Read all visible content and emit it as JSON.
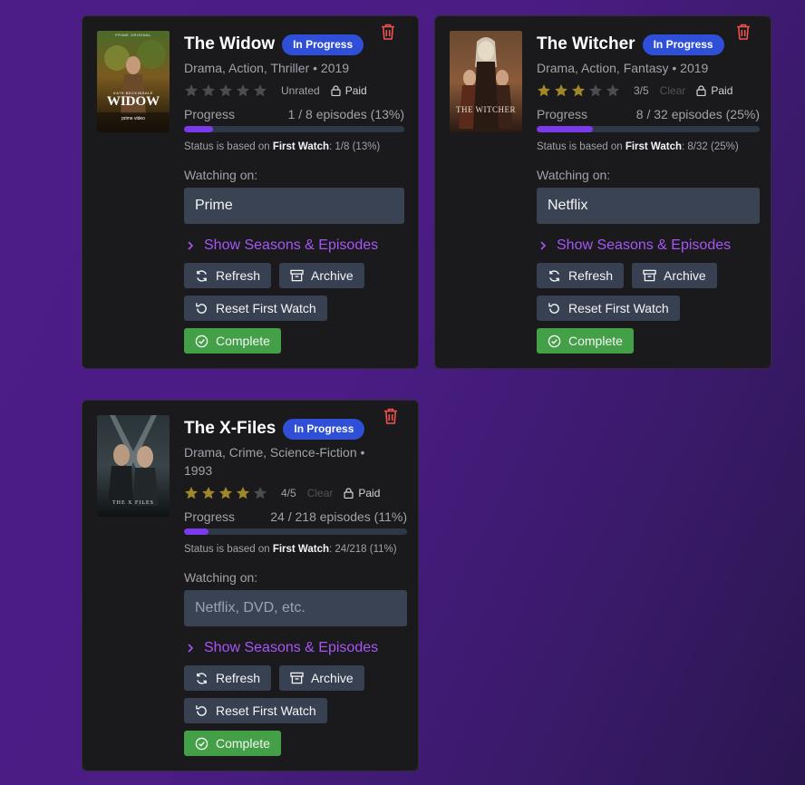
{
  "cards": [
    {
      "title": "The Widow",
      "badge": "In Progress",
      "genres": "Drama, Action, Thriller • 2019",
      "rating_text": "Unrated",
      "stars_filled": 0,
      "clear": "",
      "paid": "Paid",
      "progress_label": "Progress",
      "progress_text": "1 / 8 episodes (13%)",
      "progress_fraction": 0.13,
      "status_prefix": "Status is based on ",
      "status_strong": "First Watch",
      "status_suffix": ": 1/8 (13%)",
      "watching_label": "Watching on:",
      "watching_value": "Prime",
      "watching_placeholder": "Netflix, DVD, etc.",
      "seasons_link": "Show Seasons & Episodes",
      "refresh": "Refresh",
      "archive": "Archive",
      "reset": "Reset First Watch",
      "complete": "Complete",
      "poster": {
        "top_text": "PRIME ORIGINAL",
        "small_text": "KATE BECKINSALE",
        "big_text": "WIDOW",
        "brand": "prime video"
      }
    },
    {
      "title": "The Witcher",
      "badge": "In Progress",
      "genres": "Drama, Action, Fantasy • 2019",
      "rating_text": "3/5",
      "stars_filled": 3,
      "clear": "Clear",
      "paid": "Paid",
      "progress_label": "Progress",
      "progress_text": "8 / 32 episodes (25%)",
      "progress_fraction": 0.25,
      "status_prefix": "Status is based on ",
      "status_strong": "First Watch",
      "status_suffix": ": 8/32 (25%)",
      "watching_label": "Watching on:",
      "watching_value": "Netflix",
      "watching_placeholder": "Netflix, DVD, etc.",
      "seasons_link": "Show Seasons & Episodes",
      "refresh": "Refresh",
      "archive": "Archive",
      "reset": "Reset First Watch",
      "complete": "Complete",
      "poster": {
        "big_text": "THE WITCHER"
      }
    },
    {
      "title": "The X-Files",
      "badge": "In Progress",
      "genres": "Drama, Crime, Science-Fiction • 1993",
      "rating_text": "4/5",
      "stars_filled": 4,
      "clear": "Clear",
      "paid": "Paid",
      "progress_label": "Progress",
      "progress_text": "24 / 218 episodes (11%)",
      "progress_fraction": 0.11,
      "status_prefix": "Status is based on ",
      "status_strong": "First Watch",
      "status_suffix": ": 24/218 (11%)",
      "watching_label": "Watching on:",
      "watching_value": "",
      "watching_placeholder": "Netflix, DVD, etc.",
      "seasons_link": "Show Seasons & Episodes",
      "refresh": "Refresh",
      "archive": "Archive",
      "reset": "Reset First Watch",
      "complete": "Complete",
      "poster": {
        "big_text": "THE X FILES"
      }
    }
  ],
  "colors": {
    "accent": "#a855f7",
    "progress_fill": "#7c3aed",
    "badge": "#2f4fd8",
    "star_filled": "#a0872a",
    "star_empty": "#4b4b52",
    "complete": "#43a047",
    "trash": "#ef5350"
  },
  "icons": [
    "trash-icon",
    "star-icon",
    "lock-icon",
    "chevron-right-icon",
    "refresh-icon",
    "archive-icon",
    "reset-icon",
    "check-circle-icon"
  ]
}
